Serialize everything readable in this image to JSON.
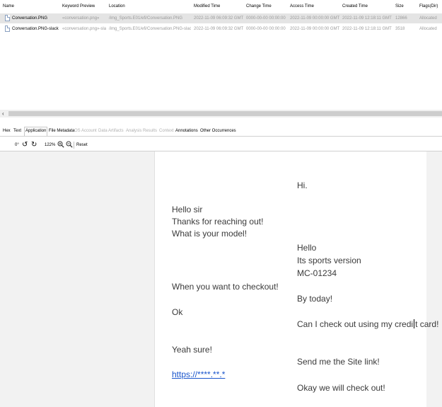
{
  "table": {
    "columns": [
      "Name",
      "Keyword Preview",
      "Location",
      "Modified Time",
      "Change Time",
      "Access Time",
      "Created Time",
      "Size",
      "Flags(Dir)"
    ],
    "rows": [
      {
        "name": "Conversation.PNG",
        "keyword_preview": "«conversation.png»",
        "location": "/img_Sports.E01/efi/Conversation.PNG",
        "modified": "2022-11-09 06:09:32 GMT",
        "change": "0000-00-00 00:00:00",
        "access": "2022-11-09 00:00:00 GMT",
        "created": "2022-11-09 12:18:11 GMT",
        "size": "12866",
        "flags": "Allocated"
      },
      {
        "name": "Conversation.PNG-slack",
        "keyword_preview": "«conversation.png»-slac",
        "location": "/img_Sports.E01/efi/Conversation.PNG-slack",
        "modified": "2022-11-09 06:09:32 GMT",
        "change": "0000-00-00 00:00:00",
        "access": "2022-11-09 00:00:00 GMT",
        "created": "2022-11-09 12:18:11 GMT",
        "size": "3518",
        "flags": "Allocated"
      }
    ]
  },
  "scroll": {
    "left_arrow": "‹"
  },
  "tabs": [
    {
      "label": "Hex"
    },
    {
      "label": "Text"
    },
    {
      "label": "Application"
    },
    {
      "label": "File Metadata"
    },
    {
      "label": "OS Account"
    },
    {
      "label": "Data Artifacts"
    },
    {
      "label": "Analysis Results"
    },
    {
      "label": "Context"
    },
    {
      "label": "Annotations"
    },
    {
      "label": "Other Occurrences"
    }
  ],
  "toolbar": {
    "rotation": "0°",
    "zoom": "122%",
    "reset_label": "Reset",
    "icons": [
      "rotate-left-icon",
      "rotate-right-icon",
      "zoom-in-icon",
      "zoom-out-icon"
    ]
  },
  "chat": {
    "left": [
      "Hello sir",
      "Thanks for reaching out!",
      "What is your model!",
      "When you want to checkout!",
      "Ok",
      "Yeah sure!",
      "https://****.**.*"
    ],
    "right": [
      "Hi.",
      "Hello",
      "Its sports version",
      "MC-01234",
      "By today!",
      "Can I check out using my credi",
      "t card!",
      "Send me the Site link!",
      "Okay we will check out!"
    ]
  },
  "colors": {
    "link": "#1a55cc",
    "selected_row": "#e4e4e4",
    "viewer_bg": "#f2f2f2"
  }
}
